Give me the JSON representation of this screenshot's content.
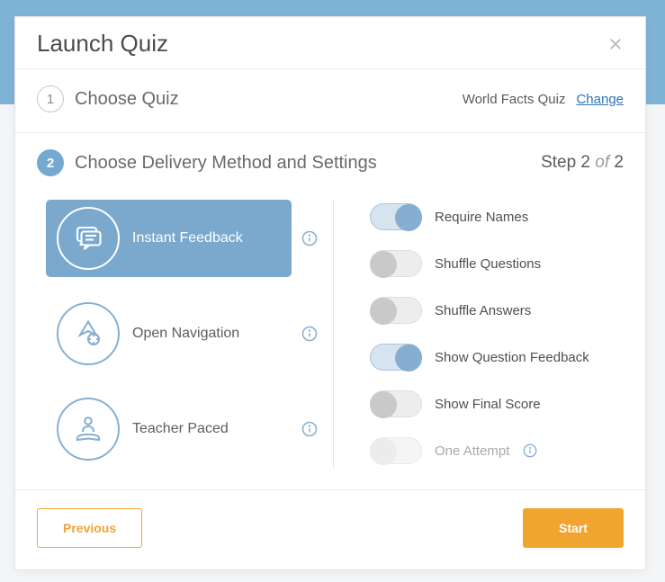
{
  "header": {
    "title": "Launch Quiz"
  },
  "step1": {
    "number": "1",
    "label": "Choose Quiz",
    "quiz_name": "World Facts Quiz",
    "change_link": "Change"
  },
  "step2": {
    "number": "2",
    "label": "Choose Delivery Method and Settings",
    "counter_prefix": "Step 2 ",
    "counter_of": "of",
    "counter_suffix": " 2"
  },
  "delivery": {
    "instant": "Instant Feedback",
    "open_nav": "Open Navigation",
    "teacher": "Teacher Paced"
  },
  "settings": {
    "require_names": "Require Names",
    "shuffle_questions": "Shuffle Questions",
    "shuffle_answers": "Shuffle Answers",
    "show_feedback": "Show Question Feedback",
    "show_score": "Show Final Score",
    "one_attempt": "One Attempt"
  },
  "footer": {
    "previous": "Previous",
    "start": "Start"
  },
  "colors": {
    "accent_blue": "#7aa9cd",
    "accent_orange": "#f2a431"
  }
}
